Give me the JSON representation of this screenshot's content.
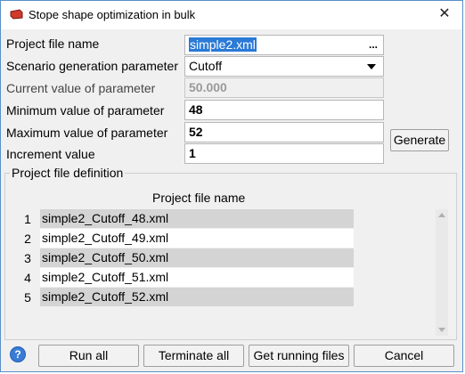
{
  "window": {
    "title": "Stope shape optimization in bulk"
  },
  "form": {
    "project_file_name": {
      "label": "Project file name",
      "value": "simple2.xml",
      "browse": "..."
    },
    "scenario_param": {
      "label": "Scenario generation parameter",
      "value": "Cutoff"
    },
    "current_value": {
      "label": "Current value of parameter",
      "value": "50.000"
    },
    "min_value": {
      "label": "Minimum value of parameter",
      "value": "48"
    },
    "max_value": {
      "label": "Maximum value of parameter",
      "value": "52"
    },
    "increment": {
      "label": "Increment value",
      "value": "1"
    },
    "generate_label": "Generate"
  },
  "definition": {
    "group_label": "Project file definition",
    "column_header": "Project file name",
    "rows": [
      {
        "num": "1",
        "file": "simple2_Cutoff_48.xml"
      },
      {
        "num": "2",
        "file": "simple2_Cutoff_49.xml"
      },
      {
        "num": "3",
        "file": "simple2_Cutoff_50.xml"
      },
      {
        "num": "4",
        "file": "simple2_Cutoff_51.xml"
      },
      {
        "num": "5",
        "file": "simple2_Cutoff_52.xml"
      }
    ]
  },
  "footer": {
    "help": "?",
    "run_all": "Run all",
    "terminate_all": "Terminate all",
    "get_running": "Get running files",
    "cancel": "Cancel"
  },
  "icons": {
    "close": "close-icon",
    "app": "app-icon",
    "help": "help-icon"
  }
}
